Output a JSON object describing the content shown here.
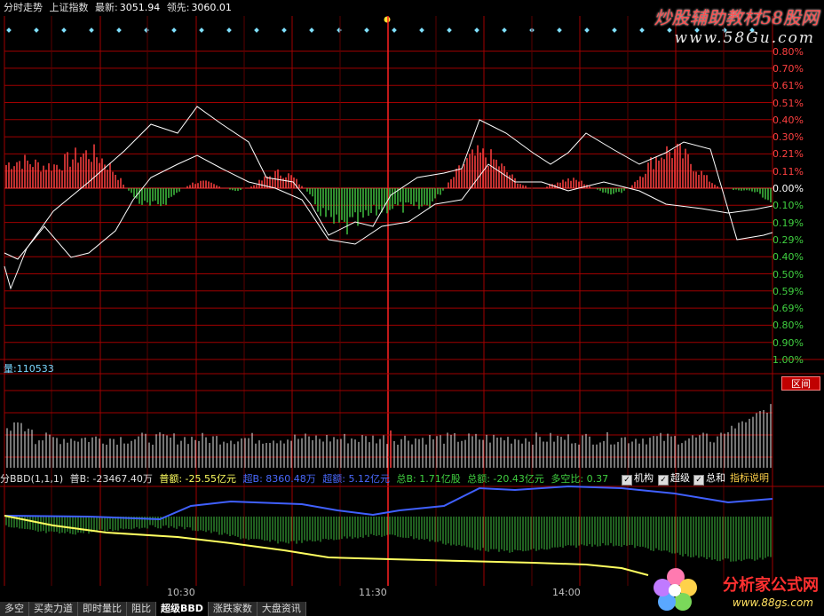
{
  "header": {
    "title": "分时走势",
    "index_name": "上证指数",
    "latest_label": "最新:",
    "latest_value": "3051.94",
    "prev_label": "领先:",
    "prev_value": "3060.01"
  },
  "watermark": {
    "top_text": "炒股辅助教材58股网",
    "top_url": "www.58Gu.com",
    "bottom_text": "分析家公式网",
    "bottom_url": "www.88gs.com"
  },
  "price_axis": {
    "up_labels": [
      "0.80%",
      "0.70%",
      "0.61%",
      "0.51%",
      "0.40%",
      "0.30%",
      "0.21%",
      "0.11%"
    ],
    "zero_label": "0.00%",
    "down_labels": [
      "0.10%",
      "0.19%",
      "0.29%",
      "0.40%",
      "0.50%",
      "0.59%",
      "0.69%",
      "0.80%",
      "0.90%",
      "1.00%"
    ]
  },
  "volume": {
    "label": "量:",
    "value": "110533"
  },
  "interval_button": "区间",
  "bbd": {
    "name": "分BBD(1,1,1)",
    "retail_b": "普B: -23467.40万",
    "retail_amt": "普额: -25.55亿元",
    "super_b": "超B: 8360.48万",
    "super_amt": "超额: 5.12亿元",
    "total_b": "总B: 1.71亿股",
    "total_amt": "总额: -20.43亿元",
    "ratio": "多空比: 0.37"
  },
  "options": [
    {
      "label": "机构",
      "checked": true
    },
    {
      "label": "超级",
      "checked": true
    },
    {
      "label": "总和",
      "checked": true
    }
  ],
  "legend_link": "指标说明",
  "time_labels": [
    "10:30",
    "11:30",
    "14:00"
  ],
  "tabs": [
    {
      "label": "多空",
      "active": false
    },
    {
      "label": "买卖力道",
      "active": false
    },
    {
      "label": "即时量比",
      "active": false
    },
    {
      "label": "阻比",
      "active": false
    },
    {
      "label": "超级BBD",
      "active": true
    },
    {
      "label": "涨跌家数",
      "active": false
    },
    {
      "label": "大盘资讯",
      "active": false
    }
  ],
  "colors": {
    "grid": "#a00000",
    "up": "#ff4040",
    "down": "#40c040",
    "line_white": "#ffffff",
    "line_blue": "#4060ff",
    "line_yellow": "#ffff60",
    "axis_up": "#ff4040",
    "axis_down": "#40d040"
  }
}
